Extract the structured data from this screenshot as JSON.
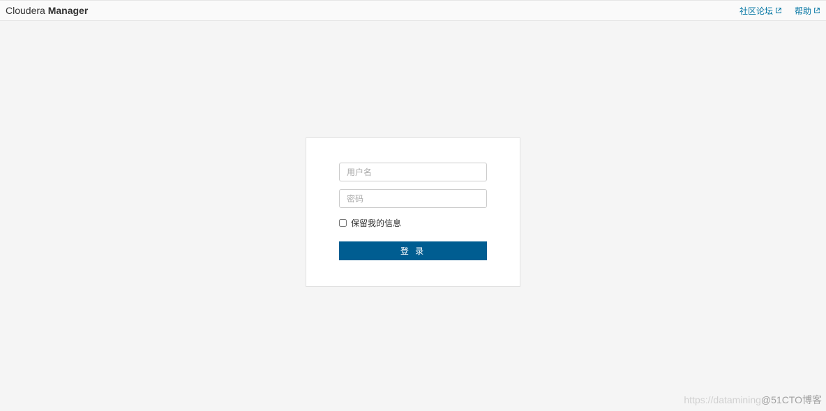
{
  "header": {
    "brand_light": "Cloudera ",
    "brand_bold": "Manager",
    "links": {
      "community": "社区论坛",
      "help": "帮助"
    }
  },
  "login": {
    "username_placeholder": "用户名",
    "password_placeholder": "密码",
    "remember_label": "保留我的信息",
    "submit_label": "登 录"
  },
  "watermark": {
    "faint": "https://datamining",
    "bold": "@51CTO博客"
  }
}
